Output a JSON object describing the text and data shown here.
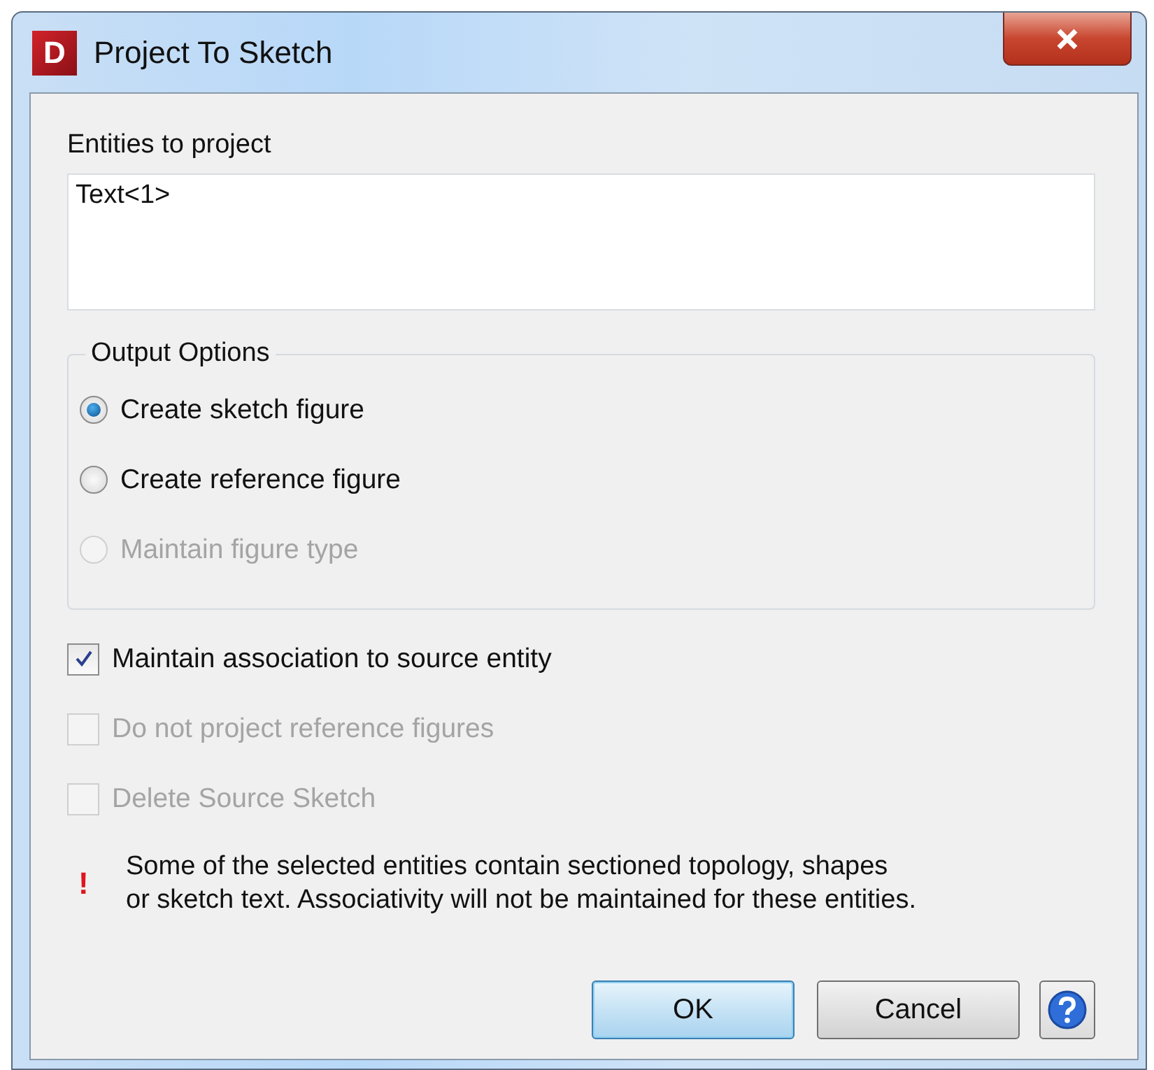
{
  "window": {
    "logo": "D",
    "title": "Project To Sketch"
  },
  "entities": {
    "label": "Entities to project",
    "items": [
      "Text<1>"
    ]
  },
  "output_options": {
    "title": "Output Options",
    "options": [
      {
        "label": "Create sketch figure",
        "selected": true,
        "disabled": false
      },
      {
        "label": "Create reference figure",
        "selected": false,
        "disabled": false
      },
      {
        "label": "Maintain figure type",
        "selected": false,
        "disabled": true
      }
    ]
  },
  "checkboxes": [
    {
      "label": "Maintain association to source entity",
      "checked": true,
      "disabled": false
    },
    {
      "label": "Do not project reference figures",
      "checked": false,
      "disabled": true
    },
    {
      "label": "Delete Source Sketch",
      "checked": false,
      "disabled": true
    }
  ],
  "warning": {
    "icon": "!",
    "text": "Some of the selected entities contain sectioned topology, shapes\nor sketch text. Associativity will not be maintained for these entities."
  },
  "buttons": [
    {
      "label": "OK",
      "kind": "default"
    },
    {
      "label": "Cancel",
      "kind": "normal"
    }
  ]
}
